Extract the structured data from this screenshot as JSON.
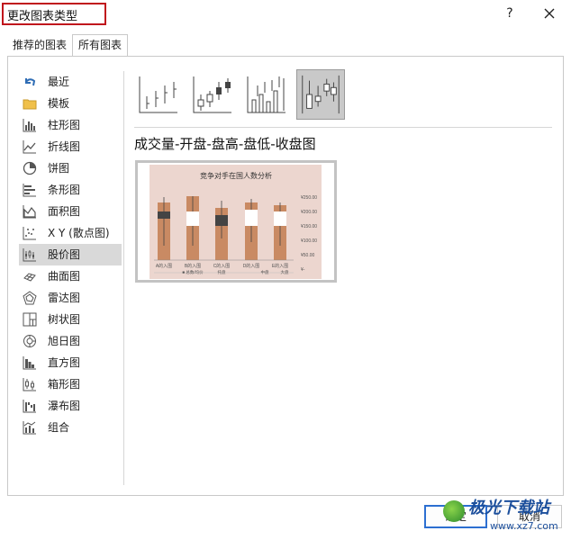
{
  "window": {
    "title": "更改图表类型",
    "help_label": "?",
    "close_icon": "close-icon"
  },
  "tabs": [
    {
      "label": "推荐的图表",
      "active": false
    },
    {
      "label": "所有图表",
      "active": true
    }
  ],
  "sidebar": {
    "items": [
      {
        "label": "最近",
        "icon": "undo-icon"
      },
      {
        "label": "模板",
        "icon": "folder-icon"
      },
      {
        "label": "柱形图",
        "icon": "column-chart-icon"
      },
      {
        "label": "折线图",
        "icon": "line-chart-icon"
      },
      {
        "label": "饼图",
        "icon": "pie-chart-icon"
      },
      {
        "label": "条形图",
        "icon": "bar-chart-icon"
      },
      {
        "label": "面积图",
        "icon": "area-chart-icon"
      },
      {
        "label": "X Y (散点图)",
        "icon": "scatter-chart-icon"
      },
      {
        "label": "股价图",
        "icon": "stock-chart-icon",
        "selected": true
      },
      {
        "label": "曲面图",
        "icon": "surface-chart-icon"
      },
      {
        "label": "雷达图",
        "icon": "radar-chart-icon"
      },
      {
        "label": "树状图",
        "icon": "treemap-icon"
      },
      {
        "label": "旭日图",
        "icon": "sunburst-icon"
      },
      {
        "label": "直方图",
        "icon": "histogram-icon"
      },
      {
        "label": "箱形图",
        "icon": "box-whisker-icon"
      },
      {
        "label": "瀑布图",
        "icon": "waterfall-icon"
      },
      {
        "label": "组合",
        "icon": "combo-chart-icon"
      }
    ]
  },
  "subtypes": [
    {
      "icon": "high-low-close-icon",
      "selected": false
    },
    {
      "icon": "open-high-low-close-icon",
      "selected": false
    },
    {
      "icon": "volume-high-low-close-icon",
      "selected": false
    },
    {
      "icon": "volume-open-high-low-close-icon",
      "selected": true
    }
  ],
  "selected_chart_name": "成交量-开盘-盘高-盘低-收盘图",
  "preview": {
    "title": "竞争对手在国人数分析",
    "ticks": [
      "¥250.00",
      "¥200.00",
      "¥150.00",
      "¥100.00",
      "¥50.00",
      "¥-"
    ],
    "categories": [
      "A的入围",
      "B的入围",
      "C的入围",
      "D的入围",
      "E的入围"
    ],
    "sublabels": [
      "托盘",
      "中盘",
      "大盘"
    ],
    "legend": "■ 总数/均价"
  },
  "footer": {
    "ok_label": "确定",
    "cancel_label": "取消"
  },
  "watermark": {
    "main": "极光下载站",
    "sub": "www.xz7.com"
  },
  "colors": {
    "highlight": "#c0141c",
    "selected_bg": "#d9d9d9",
    "preview_bg": "#ecd6cf",
    "bar": "#c98a63",
    "ok_border": "#2c6fd1"
  }
}
